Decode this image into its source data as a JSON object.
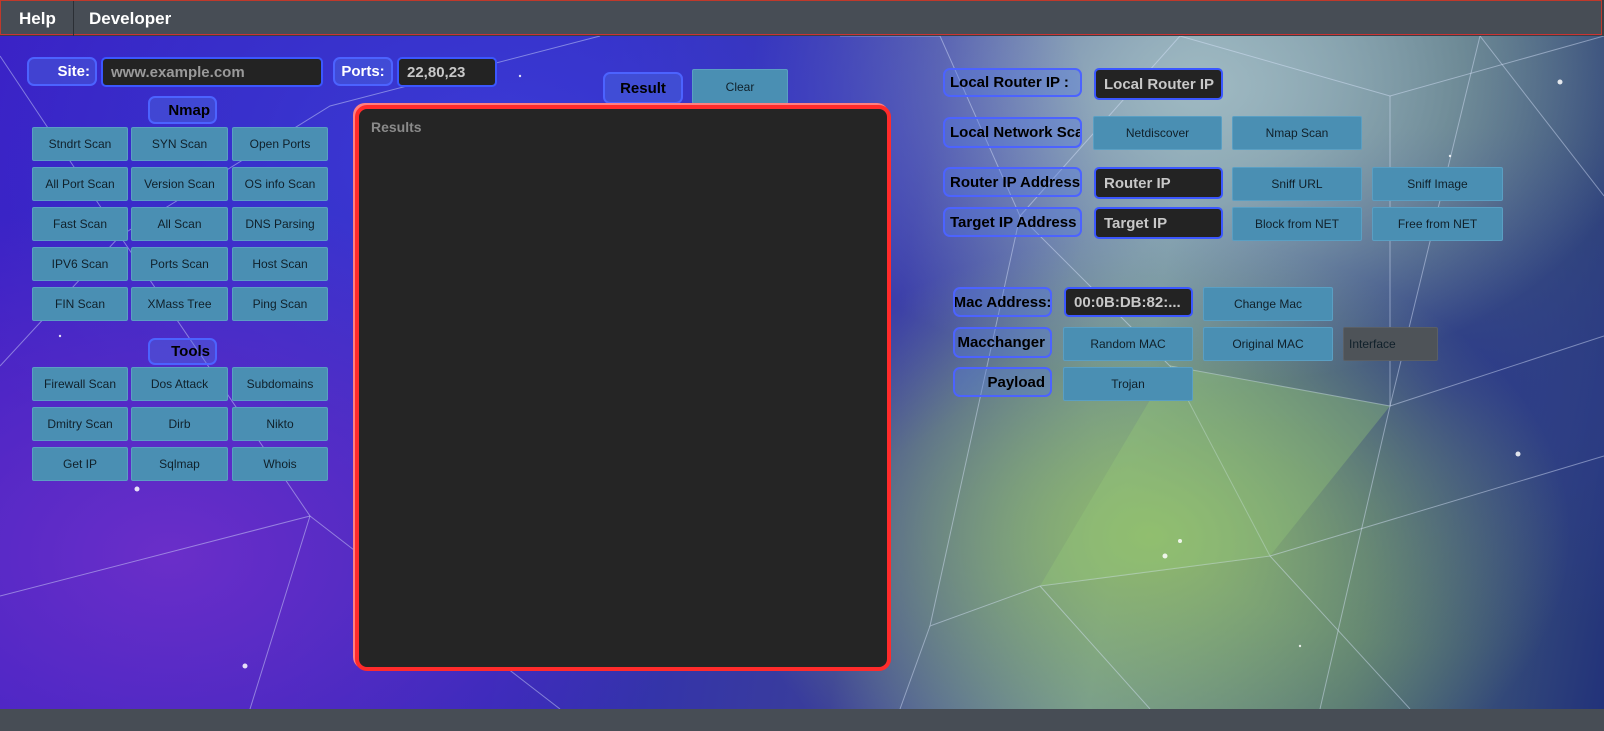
{
  "menu": {
    "help": "Help",
    "developer": "Developer"
  },
  "site": {
    "label": "Site:",
    "placeholder": "www.example.com"
  },
  "ports": {
    "label": "Ports:",
    "value": "22,80,23"
  },
  "nmap": {
    "header": "Nmap",
    "buttons": [
      "Stndrt Scan",
      "SYN Scan",
      "Open Ports",
      "All Port Scan",
      "Version Scan",
      "OS info Scan",
      "Fast Scan",
      "All Scan",
      "DNS Parsing",
      "IPV6 Scan",
      "Ports Scan",
      "Host Scan",
      "FIN Scan",
      "XMass Tree",
      "Ping Scan"
    ]
  },
  "tools": {
    "header": "Tools",
    "buttons": [
      "Firewall Scan",
      "Dos Attack",
      "Subdomains",
      "Dmitry Scan",
      "Dirb",
      "Nikto",
      "Get IP",
      "Sqlmap",
      "Whois"
    ]
  },
  "result": {
    "label": "Result",
    "clear": "Clear",
    "results_title": "Results"
  },
  "network": {
    "local_router_label": "Local Router IP :",
    "local_router_field": "Local Router IP",
    "local_network_label": "Local Network Scan",
    "netdiscover": "Netdiscover",
    "nmap_scan": "Nmap Scan",
    "router_ip_label": "Router IP Address",
    "router_ip_field": "Router IP",
    "sniff_url": "Sniff URL",
    "sniff_image": "Sniff Image",
    "target_ip_label": "Target IP Address",
    "target_ip_field": "Target IP",
    "block_net": "Block from NET",
    "free_net": "Free from NET"
  },
  "mac": {
    "mac_label": "Mac Address:",
    "mac_value": "00:0B:DB:82:...",
    "change_mac": "Change Mac",
    "macchanger_label": "Macchanger",
    "random_mac": "Random MAC",
    "original_mac": "Original MAC",
    "interface": "Interface",
    "payload_label": "Payload",
    "trojan": "Trojan"
  }
}
